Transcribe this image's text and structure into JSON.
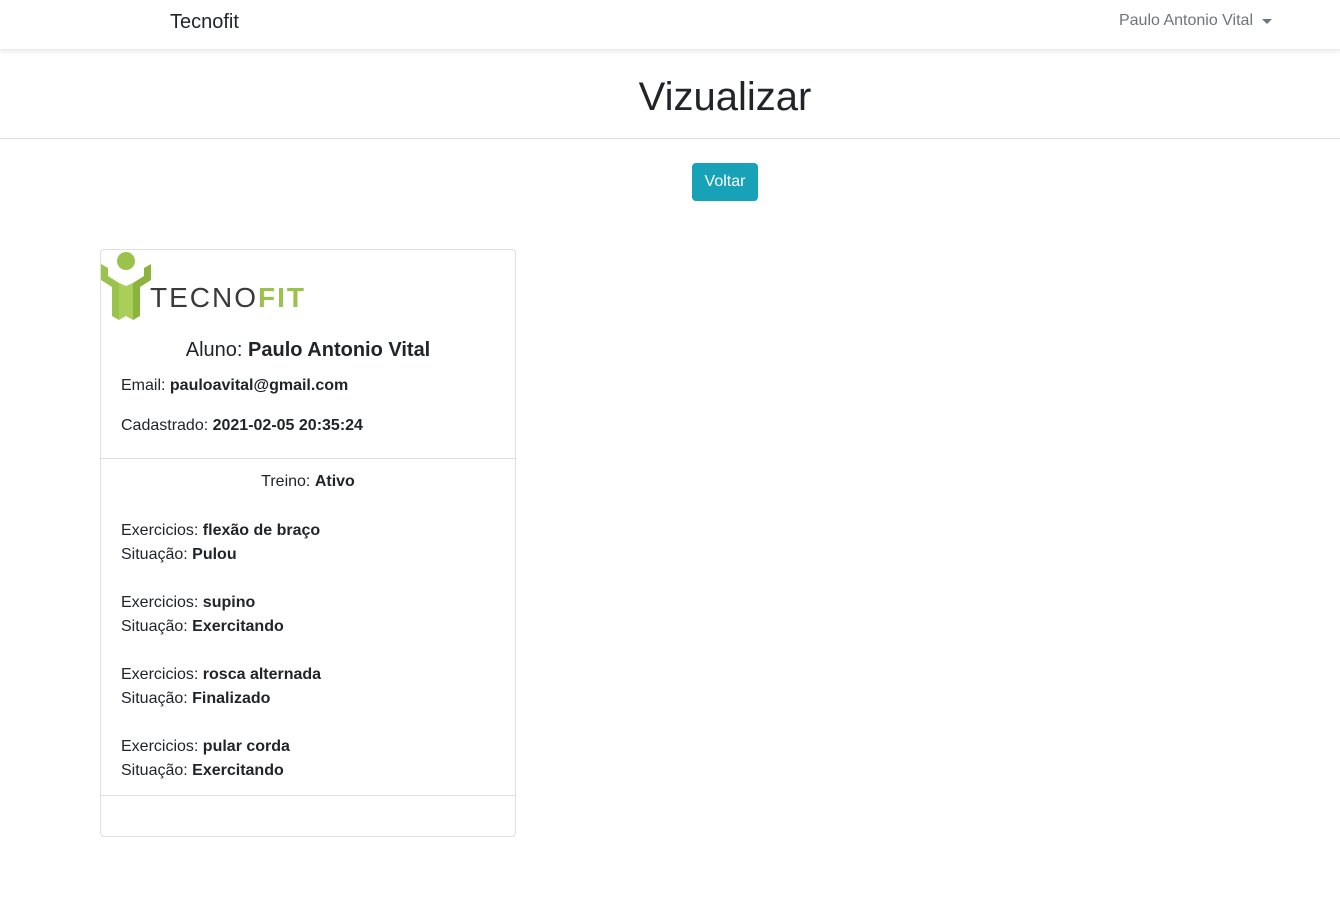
{
  "navbar": {
    "brand": "Tecnofit",
    "user_name": "Paulo Antonio Vital"
  },
  "page": {
    "title": "Vizualizar",
    "back_button": "Voltar"
  },
  "card": {
    "logo": {
      "text_dark": "TECNO",
      "text_green": "FIT"
    },
    "aluno_label": "Aluno: ",
    "aluno_name": "Paulo Antonio Vital",
    "email_label": "Email: ",
    "email_value": "pauloavital@gmail.com",
    "cadastrado_label": "Cadastrado: ",
    "cadastrado_value": "2021-02-05 20:35:24",
    "treino_label": "Treino: ",
    "treino_value": "Ativo",
    "exercicio_label": "Exercicios: ",
    "situacao_label": "Situação: ",
    "exercicios": [
      {
        "nome": "flexão de braço",
        "situacao": "Pulou"
      },
      {
        "nome": "supino",
        "situacao": "Exercitando"
      },
      {
        "nome": "rosca alternada",
        "situacao": "Finalizado"
      },
      {
        "nome": "pular corda",
        "situacao": "Exercitando"
      }
    ]
  },
  "colors": {
    "accent": "#17a2b8",
    "logo_green": "#9bc24a"
  }
}
